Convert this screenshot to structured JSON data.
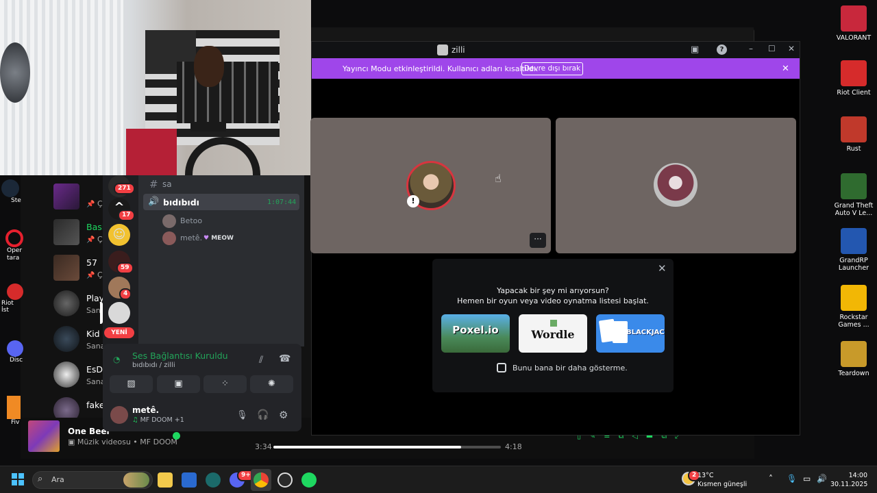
{
  "discord_window": {
    "title": "zilli",
    "streamer_banner": {
      "text": "Yayıncı Modu etkinleştirildi. Kullanıcı adları kısaltıldı.",
      "button": "Devre dışı bırak"
    },
    "activity_prompt": {
      "line1": "Yapacak bir şey mi arıyorsun?",
      "line2": "Hemen bir oyun veya video oynatma listesi başlat.",
      "cards": [
        "Poxel.io",
        "Wordle",
        "BLACKJACK"
      ],
      "checkbox_label": "Bunu bana bir daha gösterme."
    }
  },
  "discord_sidebar": {
    "text_channel": "sa",
    "voice_channel": {
      "name": "bıdıbıdı",
      "timer": "1:07:44"
    },
    "members": [
      {
        "name": "Betoo"
      },
      {
        "name": "metê.",
        "tag": "MEOW"
      }
    ],
    "server_badges": [
      "271",
      "17",
      "59",
      "4"
    ],
    "new_label": "YENİ",
    "voice_status": {
      "title": "Ses Bağlantısı Kuruldu",
      "subtitle": "bıdıbıdı / zilli"
    },
    "user": {
      "name": "metê.",
      "activity": "MF DOOM +1"
    }
  },
  "spotify": {
    "list": [
      {
        "title": "",
        "subtitle": "Çalma l"
      },
      {
        "title": "Basim ag",
        "subtitle": "Çalma l"
      },
      {
        "title": "57",
        "subtitle": "Çalma l"
      },
      {
        "title": "Playboi C",
        "subtitle": "Sanatçı"
      },
      {
        "title": "Kid Cudi",
        "subtitle": "Sanatçı"
      },
      {
        "title": "EsDeeKi",
        "subtitle": "Sanatçı"
      },
      {
        "title": "fakemink",
        "subtitle": ""
      }
    ],
    "now_playing": {
      "title": "One Beer",
      "subtitle": "Müzik videosu • MF DOOM"
    },
    "time_current": "3:34",
    "time_total": "4:18",
    "progress": 0.825
  },
  "desktop_icons": [
    {
      "label": "VALORANT",
      "color": "#c8283c"
    },
    {
      "label": "Riot Client",
      "color": "#d62b2b"
    },
    {
      "label": "Rust",
      "color": "#c0392b"
    },
    {
      "label": "Grand Theft Auto V Le...",
      "color": "#2f6b2f"
    },
    {
      "label": "GrandRP Launcher",
      "color": "#2357b0"
    },
    {
      "label": "Rockstar Games ...",
      "color": "#f2b705"
    },
    {
      "label": "Teardown",
      "color": "#c89a2a"
    }
  ],
  "left_desktop_labels": [
    "Ste",
    "Oper tara",
    "Riot İst",
    "Disc",
    "Fiv"
  ],
  "taskbar": {
    "search_placeholder": "Ara",
    "weather_temp": "13°C",
    "weather_desc": "Kısmen güneşli",
    "weather_badge": "2",
    "time": "14:00",
    "date": "30.11.2025",
    "discord_badge": "9+"
  }
}
